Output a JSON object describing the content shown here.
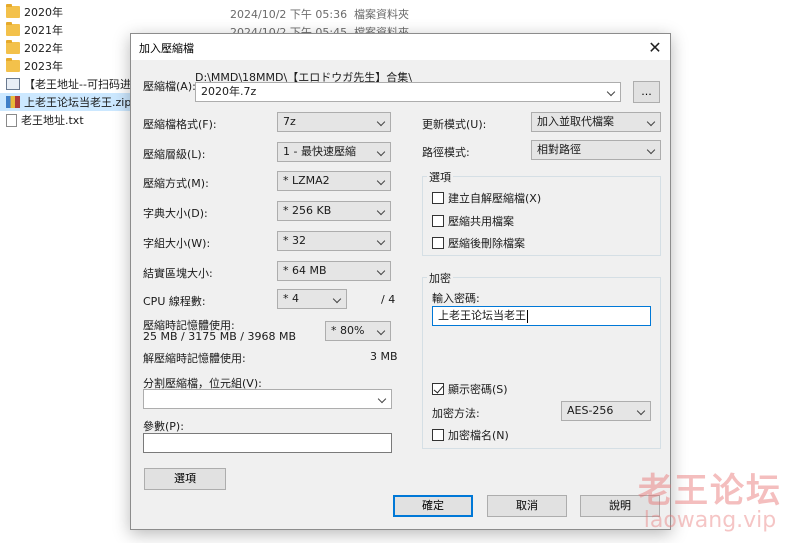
{
  "explorer": {
    "rows": [
      {
        "name": "2020年",
        "icon": "folder-icon",
        "date": "2024/10/2 下午 05:36",
        "type": "檔案資料夾"
      },
      {
        "name": "2021年",
        "icon": "folder-icon",
        "date": "2024/10/2 下午 05:45",
        "type": "檔案資料夾"
      },
      {
        "name": "2022年",
        "icon": "folder-icon",
        "date": "",
        "type": ""
      },
      {
        "name": "2023年",
        "icon": "folder-icon",
        "date": "",
        "type": ""
      },
      {
        "name": "【老王地址--可扫码进入",
        "icon": "image-file-icon",
        "date": "",
        "type": ""
      },
      {
        "name": "上老王论坛当老王.zip",
        "icon": "zip-file-icon",
        "date": "",
        "type": ""
      },
      {
        "name": "老王地址.txt",
        "icon": "text-file-icon",
        "date": "",
        "type": ""
      }
    ]
  },
  "dialog": {
    "title": "加入壓縮檔",
    "close_label": "✕",
    "archive": {
      "label": "壓縮檔(A):",
      "path": "D:\\MMD\\18MMD\\【エロドウガ先生】合集\\",
      "value": "2020年.7z",
      "browse_label": "..."
    },
    "left": {
      "format": {
        "label": "壓縮檔格式(F):",
        "value": "7z"
      },
      "level": {
        "label": "壓縮層級(L):",
        "value": "1 - 最快速壓縮"
      },
      "method": {
        "label": "壓縮方式(M):",
        "value": "* LZMA2"
      },
      "dict": {
        "label": "字典大小(D):",
        "value": "* 256 KB"
      },
      "word": {
        "label": "字組大小(W):",
        "value": "* 32"
      },
      "solid": {
        "label": "結實區塊大小:",
        "value": "* 64 MB"
      },
      "threads": {
        "label": "CPU 線程數:",
        "value": "* 4",
        "max": "/ 4"
      },
      "mem": {
        "label": "壓縮時記憶體使用:",
        "detail": "25 MB / 3175 MB / 3968 MB",
        "value": "* 80%"
      },
      "decomp": {
        "label": "解壓縮時記憶體使用:",
        "value": "3 MB"
      },
      "split": {
        "label": "分割壓縮檔，位元組(V):",
        "value": ""
      },
      "params": {
        "label": "參數(P):",
        "value": ""
      },
      "options_button": "選項"
    },
    "right": {
      "update": {
        "label": "更新模式(U):",
        "value": "加入並取代檔案"
      },
      "path": {
        "label": "路徑模式:",
        "value": "相對路徑"
      },
      "options": {
        "title": "選項",
        "sfx": "建立自解壓縮檔(X)",
        "shared": "壓縮共用檔案",
        "delete": "壓縮後刪除檔案"
      },
      "encryption": {
        "title": "加密",
        "password_label": "輸入密碼:",
        "password_value": "上老王论坛当老王",
        "show_password": "顯示密碼(S)",
        "method_label": "加密方法:",
        "method_value": "AES-256",
        "encrypt_names": "加密檔名(N)"
      }
    },
    "buttons": {
      "ok": "確定",
      "cancel": "取消",
      "help": "說明"
    }
  },
  "watermark": {
    "line1": "老王论坛",
    "line2": "laowang.vip"
  }
}
